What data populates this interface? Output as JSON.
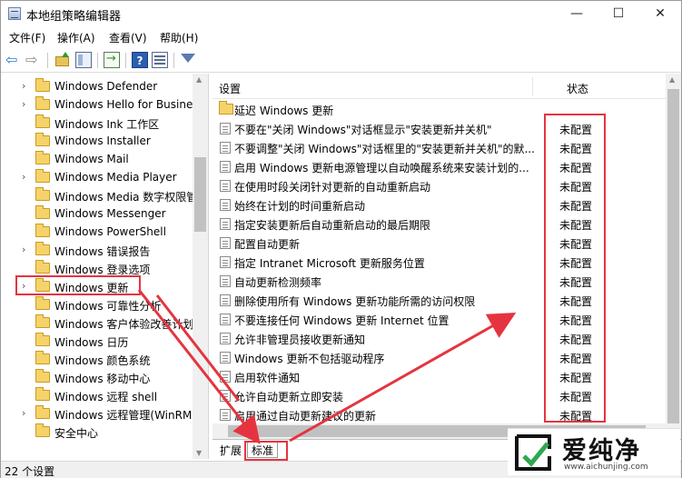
{
  "window": {
    "title": "本地组策略编辑器",
    "controls": {
      "minimize": "—",
      "maximize": "☐",
      "close": "✕"
    }
  },
  "menu": [
    "文件(F)",
    "操作(A)",
    "查看(V)",
    "帮助(H)"
  ],
  "toolbar": {
    "back": "back-icon",
    "forward": "forward-icon",
    "up": "up-folder-icon",
    "show_hide": "show-hide-tree-icon",
    "export": "export-list-icon",
    "help": "?",
    "view": "view-icon",
    "filter": "filter-icon"
  },
  "tree": [
    {
      "label": "Windows Defender",
      "expandable": true
    },
    {
      "label": "Windows Hello for Busine",
      "expandable": true
    },
    {
      "label": "Windows Ink 工作区",
      "expandable": false
    },
    {
      "label": "Windows Installer",
      "expandable": false
    },
    {
      "label": "Windows Mail",
      "expandable": false
    },
    {
      "label": "Windows Media Player",
      "expandable": true
    },
    {
      "label": "Windows Media 数字权限管",
      "expandable": false
    },
    {
      "label": "Windows Messenger",
      "expandable": false
    },
    {
      "label": "Windows PowerShell",
      "expandable": false
    },
    {
      "label": "Windows 错误报告",
      "expandable": true
    },
    {
      "label": "Windows 登录选项",
      "expandable": false
    },
    {
      "label": "Windows 更新",
      "expandable": true,
      "selected": true
    },
    {
      "label": "Windows 可靠性分析",
      "expandable": false
    },
    {
      "label": "Windows 客户体验改善计划",
      "expandable": false
    },
    {
      "label": "Windows 日历",
      "expandable": false
    },
    {
      "label": "Windows 颜色系统",
      "expandable": false
    },
    {
      "label": "Windows 移动中心",
      "expandable": false
    },
    {
      "label": "Windows 远程 shell",
      "expandable": false
    },
    {
      "label": "Windows 远程管理(WinRM",
      "expandable": true
    },
    {
      "label": "安全中心",
      "expandable": false
    }
  ],
  "list": {
    "header_setting": "设置",
    "header_status": "状态",
    "rows": [
      {
        "label": "延迟 Windows 更新",
        "status": "",
        "type": "folder"
      },
      {
        "label": "不要在\"关闭 Windows\"对话框显示\"安装更新并关机\"",
        "status": "未配置",
        "type": "setting"
      },
      {
        "label": "不要调整\"关闭 Windows\"对话框里的\"安装更新并关机\"的默...",
        "status": "未配置",
        "type": "setting"
      },
      {
        "label": "启用 Windows 更新电源管理以自动唤醒系统来安装计划的...",
        "status": "未配置",
        "type": "setting"
      },
      {
        "label": "在使用时段关闭针对更新的自动重新启动",
        "status": "未配置",
        "type": "setting"
      },
      {
        "label": "始终在计划的时间重新启动",
        "status": "未配置",
        "type": "setting"
      },
      {
        "label": "指定安装更新后自动重新启动的最后期限",
        "status": "未配置",
        "type": "setting"
      },
      {
        "label": "配置自动更新",
        "status": "未配置",
        "type": "setting"
      },
      {
        "label": "指定 Intranet Microsoft 更新服务位置",
        "status": "未配置",
        "type": "setting"
      },
      {
        "label": "自动更新检测频率",
        "status": "未配置",
        "type": "setting"
      },
      {
        "label": "删除使用所有 Windows 更新功能所需的访问权限",
        "status": "未配置",
        "type": "setting"
      },
      {
        "label": "不要连接任何 Windows 更新 Internet 位置",
        "status": "未配置",
        "type": "setting"
      },
      {
        "label": "允许非管理员接收更新通知",
        "status": "未配置",
        "type": "setting"
      },
      {
        "label": "Windows 更新不包括驱动程序",
        "status": "未配置",
        "type": "setting"
      },
      {
        "label": "启用软件通知",
        "status": "未配置",
        "type": "setting"
      },
      {
        "label": "允许自动更新立即安装",
        "status": "未配置",
        "type": "setting"
      },
      {
        "label": "启用通过自动更新建议的更新",
        "status": "未配置",
        "type": "setting"
      }
    ]
  },
  "tabs": {
    "extended": "扩展",
    "standard": "标准"
  },
  "status_bar": "22 个设置",
  "watermark": {
    "title": "爱纯净",
    "url": "www.aichunjing.com"
  },
  "colors": {
    "annotation_red": "#e5343f",
    "folder_yellow": "#f6d36a"
  }
}
